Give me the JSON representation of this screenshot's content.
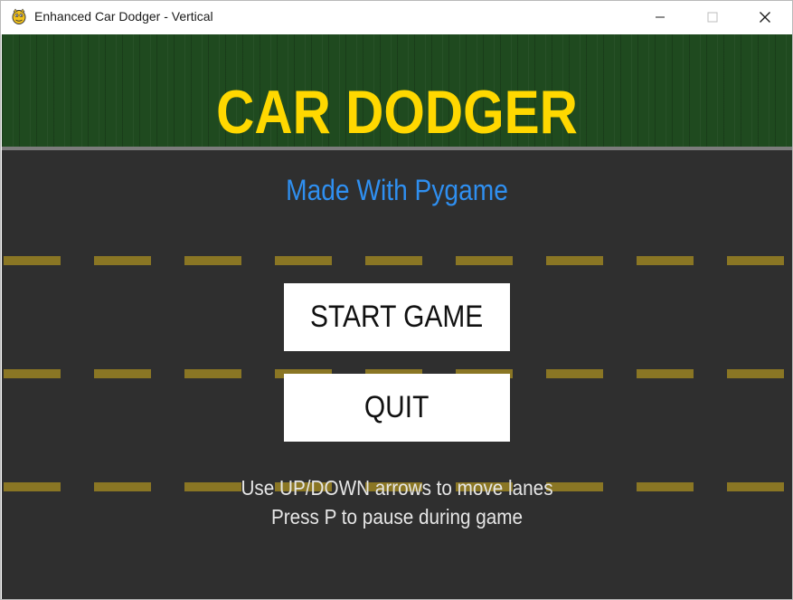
{
  "window": {
    "title": "Enhanced Car Dodger - Vertical",
    "app_icon": "pygame-snake-icon",
    "controls": [
      "minimize-icon",
      "maximize-icon",
      "close-icon"
    ]
  },
  "game": {
    "title": "CAR DODGER",
    "subtitle": "Made With Pygame",
    "buttons": {
      "start_label": "START GAME",
      "quit_label": "QUIT"
    },
    "instructions": [
      "Use UP/DOWN arrows to move lanes",
      "Press P to pause during game"
    ],
    "colors": {
      "title": "#ffd800",
      "subtitle": "#2f8ff0",
      "road": "#2f2f2f",
      "grass": "#1f4a1f",
      "lane_dash": "#8a7624",
      "button_bg": "#ffffff",
      "button_text": "#111111",
      "instruction_text": "#e6e6e6"
    }
  }
}
